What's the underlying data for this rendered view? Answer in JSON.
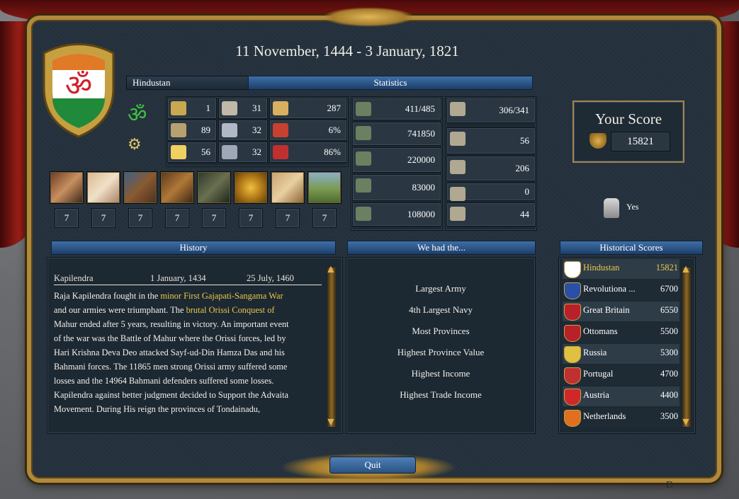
{
  "title": "11 November, 1444 - 3 January, 1821",
  "country": "Hindustan",
  "statistics_label": "Statistics",
  "stats_left": [
    {
      "icon": "scales-icon",
      "value": "1"
    },
    {
      "icon": "medal-icon",
      "value": "89"
    },
    {
      "icon": "idea-bulb-icon",
      "value": "56"
    },
    {
      "icon": "scroll-quill-icon",
      "value": "31"
    },
    {
      "icon": "diplomacy-icon",
      "value": "32"
    },
    {
      "icon": "military-icon",
      "value": "32"
    },
    {
      "icon": "gold-pile-icon",
      "value": "287"
    },
    {
      "icon": "inflation-icon",
      "value": "6%"
    },
    {
      "icon": "heart-sword-icon",
      "value": "86%"
    }
  ],
  "stats_military": [
    {
      "icon": "provinces-icon",
      "value": "411/485"
    },
    {
      "icon": "soldiers-icon",
      "value": "741850"
    },
    {
      "icon": "infantry-icon",
      "value": "220000"
    },
    {
      "icon": "cavalry-icon",
      "value": "83000"
    },
    {
      "icon": "artillery-icon",
      "value": "108000"
    }
  ],
  "stats_naval": [
    {
      "icon": "ports-icon",
      "value": "306/341"
    },
    {
      "icon": "ship-icon",
      "value": "56"
    },
    {
      "icon": "heavy-ship-icon",
      "value": "206"
    },
    {
      "icon": "light-ship-icon",
      "value": "0"
    },
    {
      "icon": "galley-icon",
      "value": "44"
    }
  ],
  "levels": [
    "7",
    "7",
    "7",
    "7",
    "7",
    "7",
    "7",
    "7"
  ],
  "your_score": {
    "label": "Your Score",
    "value": "15821"
  },
  "ironman": {
    "value": "Yes"
  },
  "history": {
    "banner": "History",
    "ruler": "Kapilendra",
    "start": "1 January, 1434",
    "end": "25 July, 1460",
    "lines": [
      {
        "pre": "Raja Kapilendra fought in the ",
        "hl": "minor First Gajapati-Sangama War",
        "post": ""
      },
      {
        "pre": "and our armies were triumphant. The ",
        "hl": "brutal Orissi Conquest of",
        "post": ""
      },
      {
        "pre": "Mahur ended after 5 years, resulting in victory. An important event",
        "hl": "",
        "post": ""
      },
      {
        "pre": "of the war was the Battle of Mahur where the Orissi forces, led by",
        "hl": "",
        "post": ""
      },
      {
        "pre": "Hari Krishna Deva Deo attacked Sayf-ud-Din Hamza Das and his",
        "hl": "",
        "post": ""
      },
      {
        "pre": "Bahmani forces. The 11865 men strong Orissi army suffered some",
        "hl": "",
        "post": ""
      },
      {
        "pre": "losses and the 14964 Bahmani defenders suffered some losses.",
        "hl": "",
        "post": ""
      },
      {
        "pre": "Kapilendra against better judgment decided to  Support the Advaita",
        "hl": "",
        "post": ""
      },
      {
        "pre": "Movement. During His reign the provinces of Tondainadu,",
        "hl": "",
        "post": ""
      }
    ]
  },
  "achievements": {
    "banner": "We had the...",
    "items": [
      "Largest Army",
      "4th Largest Navy",
      "Most Provinces",
      "Highest Province Value",
      "Highest Income",
      "Highest Trade Income"
    ]
  },
  "historical_scores": {
    "banner": "Historical Scores",
    "rows": [
      {
        "name": "Hindustan",
        "score": "15821",
        "highlight": true,
        "color": "#ffffff"
      },
      {
        "name": "Revolutiona ...",
        "score": "6700",
        "highlight": false,
        "color": "#2850a8"
      },
      {
        "name": "Great Britain",
        "score": "6550",
        "highlight": false,
        "color": "#b8202a"
      },
      {
        "name": "Ottomans",
        "score": "5500",
        "highlight": false,
        "color": "#b8202a"
      },
      {
        "name": "Russia",
        "score": "5300",
        "highlight": false,
        "color": "#e0c040"
      },
      {
        "name": "Portugal",
        "score": "4700",
        "highlight": false,
        "color": "#c03030"
      },
      {
        "name": "Austria",
        "score": "4400",
        "highlight": false,
        "color": "#d02828"
      },
      {
        "name": "Netherlands",
        "score": "3500",
        "highlight": false,
        "color": "#e07020"
      }
    ]
  },
  "quit_label": "Quit",
  "colors": {
    "accent_blue": "#2a5284",
    "gold": "#b08a3c",
    "highlight_text": "#ecc84a"
  }
}
